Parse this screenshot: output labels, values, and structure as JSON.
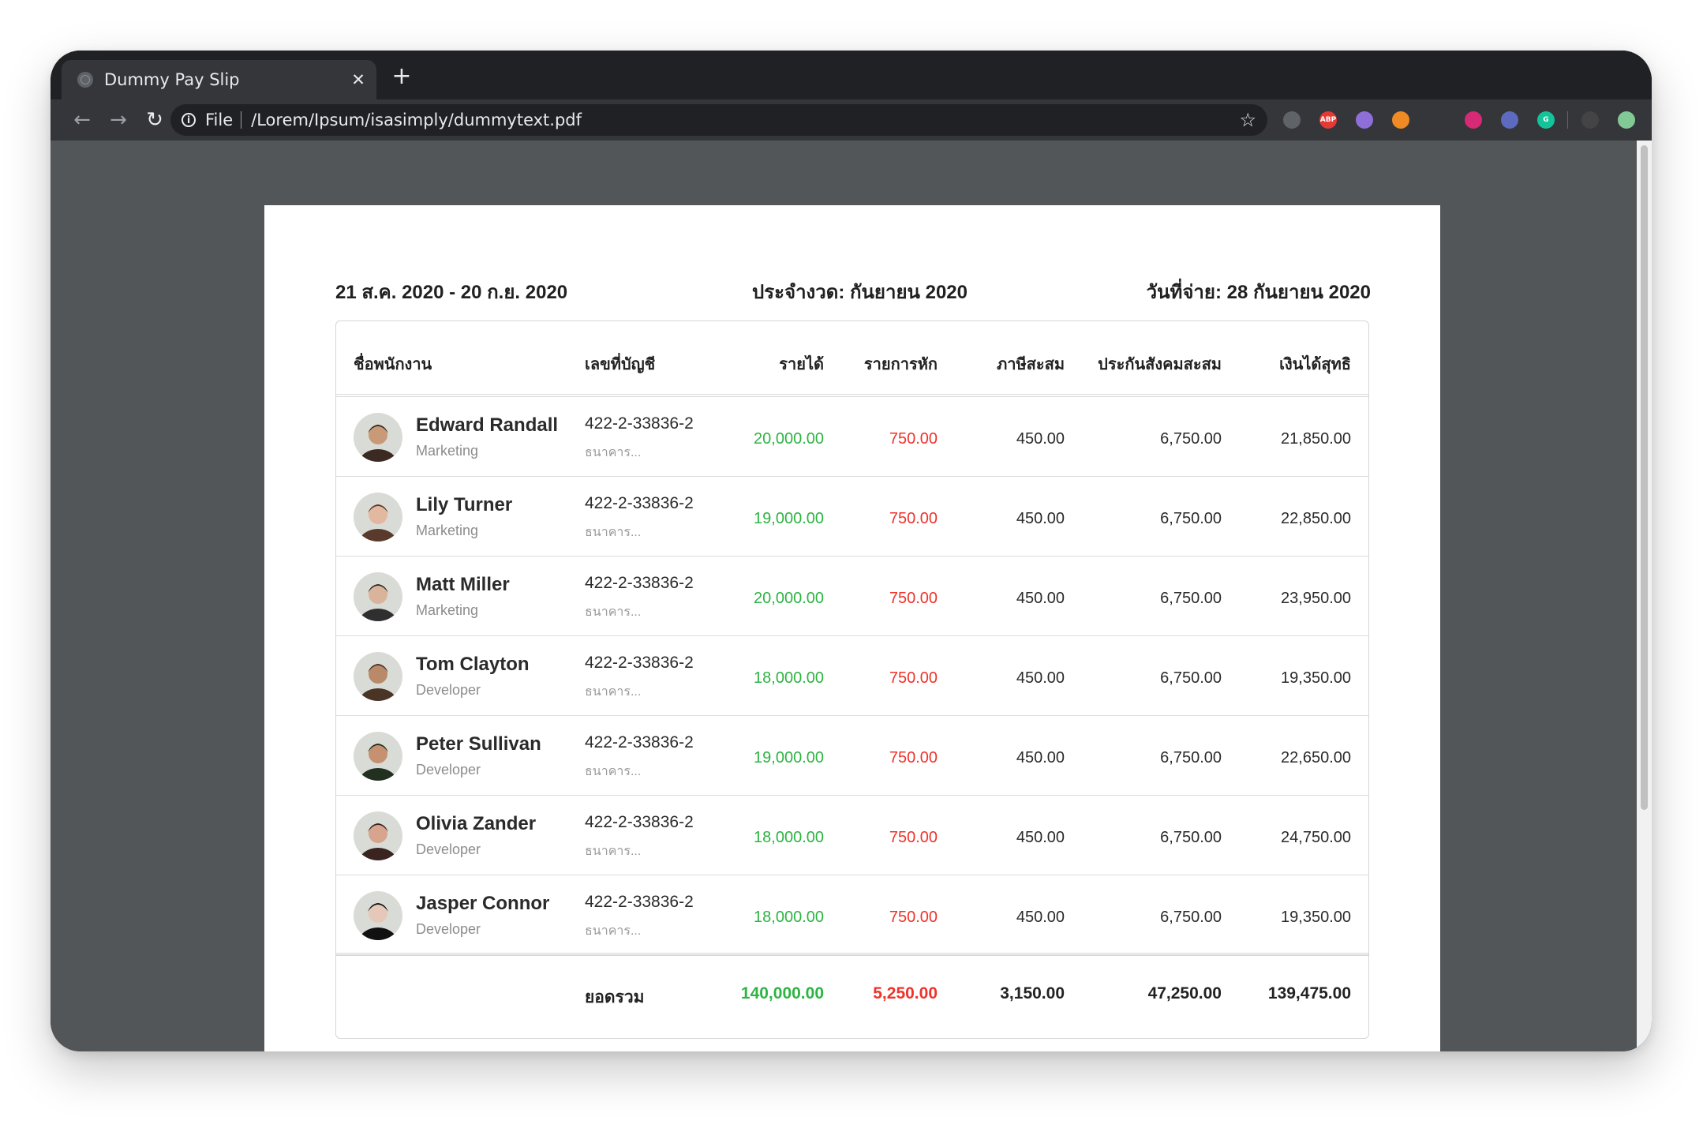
{
  "browser": {
    "tab_title": "Dummy Pay Slip",
    "tab_close": "✕",
    "new_tab": "+",
    "back": "←",
    "forward": "→",
    "reload": "↻",
    "scheme": "File",
    "url": "/Lorem/Ipsum/isasimply/dummytext.pdf",
    "bookmark": "☆",
    "extensions": [
      {
        "icon": "tab-manager-icon",
        "color": "#5f6368",
        "label": ""
      },
      {
        "icon": "adblock-icon",
        "color": "#e53935",
        "label": "ABP"
      },
      {
        "icon": "extension-icon",
        "color": "#8e6fd8",
        "label": ""
      },
      {
        "icon": "extension-icon",
        "color": "#f08a24",
        "label": ""
      },
      {
        "icon": "eye-icon",
        "color": "#e8eaed",
        "label": ""
      },
      {
        "icon": "instagram-icon",
        "color": "#d62976",
        "label": ""
      },
      {
        "icon": "extension-icon",
        "color": "#5c6bc0",
        "label": ""
      },
      {
        "icon": "grammarly-icon",
        "color": "#15c39a",
        "label": "G"
      },
      {
        "icon": "profile-avatar-icon",
        "color": "#444444",
        "label": ""
      },
      {
        "icon": "update-icon",
        "color": "#81c995",
        "label": ""
      }
    ]
  },
  "payslip": {
    "period_range": "21 ส.ค. 2020 - 20 ก.ย. 2020",
    "period_label": "ประจำงวด: กันยายน 2020",
    "pay_date": "วันที่จ่าย: 28 กันยายน 2020",
    "columns": {
      "name": "ชื่อพนักงาน",
      "account": "เลขที่บัญชี",
      "income": "รายได้",
      "deduction": "รายการหัก",
      "tax": "ภาษีสะสม",
      "social": "ประกันสังคมสะสม",
      "net": "เงินได้สุทธิ"
    },
    "employees": [
      {
        "name": "Edward Randall",
        "dept": "Marketing",
        "account": "422-2-33836-2",
        "bank": "ธนาคาร...",
        "income": "20,000.00",
        "deduction": "750.00",
        "tax": "450.00",
        "social": "6,750.00",
        "net": "21,850.00"
      },
      {
        "name": "Lily Turner",
        "dept": "Marketing",
        "account": "422-2-33836-2",
        "bank": "ธนาคาร...",
        "income": "19,000.00",
        "deduction": "750.00",
        "tax": "450.00",
        "social": "6,750.00",
        "net": "22,850.00"
      },
      {
        "name": "Matt Miller",
        "dept": "Marketing",
        "account": "422-2-33836-2",
        "bank": "ธนาคาร...",
        "income": "20,000.00",
        "deduction": "750.00",
        "tax": "450.00",
        "social": "6,750.00",
        "net": "23,950.00"
      },
      {
        "name": "Tom Clayton",
        "dept": "Developer",
        "account": "422-2-33836-2",
        "bank": "ธนาคาร...",
        "income": "18,000.00",
        "deduction": "750.00",
        "tax": "450.00",
        "social": "6,750.00",
        "net": "19,350.00"
      },
      {
        "name": "Peter Sullivan",
        "dept": "Developer",
        "account": "422-2-33836-2",
        "bank": "ธนาคาร...",
        "income": "19,000.00",
        "deduction": "750.00",
        "tax": "450.00",
        "social": "6,750.00",
        "net": "22,650.00"
      },
      {
        "name": "Olivia Zander",
        "dept": "Developer",
        "account": "422-2-33836-2",
        "bank": "ธนาคาร...",
        "income": "18,000.00",
        "deduction": "750.00",
        "tax": "450.00",
        "social": "6,750.00",
        "net": "24,750.00"
      },
      {
        "name": "Jasper Connor",
        "dept": "Developer",
        "account": "422-2-33836-2",
        "bank": "ธนาคาร...",
        "income": "18,000.00",
        "deduction": "750.00",
        "tax": "450.00",
        "social": "6,750.00",
        "net": "19,350.00"
      }
    ],
    "totals": {
      "label": "ยอดรวม",
      "income": "140,000.00",
      "deduction": "5,250.00",
      "tax": "3,150.00",
      "social": "47,250.00",
      "net": "139,475.00"
    },
    "colors": {
      "income": "#2db443",
      "deduction": "#f0322a"
    }
  }
}
